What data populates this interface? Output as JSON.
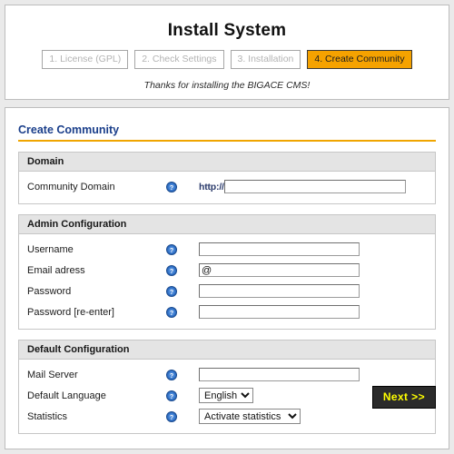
{
  "installer": {
    "title": "Install System",
    "tagline": "Thanks for installing the BIGACE CMS!",
    "steps": [
      {
        "label": "1. License (GPL)",
        "active": false
      },
      {
        "label": "2. Check Settings",
        "active": false
      },
      {
        "label": "3. Installation",
        "active": false
      },
      {
        "label": "4. Create Community",
        "active": true
      }
    ],
    "active_step_color": "#f5a200"
  },
  "page": {
    "section_title": "Create Community",
    "section_title_color": "#1b3f8b",
    "section_rule_color": "#f0a500"
  },
  "fieldsets": {
    "domain": {
      "legend": "Domain",
      "rows": [
        {
          "label": "Community Domain",
          "help_icon": "help-question-icon",
          "protocol_prefix": "http://",
          "value": "",
          "placeholder": ""
        }
      ]
    },
    "admin": {
      "legend": "Admin Configuration",
      "rows": [
        {
          "label": "Username",
          "help_icon": "help-question-icon",
          "value": "",
          "placeholder": ""
        },
        {
          "label": "Email adress",
          "help_icon": "help-question-icon",
          "value": "@",
          "placeholder": ""
        },
        {
          "label": "Password",
          "help_icon": "help-question-icon",
          "value": "",
          "placeholder": ""
        },
        {
          "label": "Password [re-enter]",
          "help_icon": "help-question-icon",
          "value": "",
          "placeholder": ""
        }
      ]
    },
    "defaults": {
      "legend": "Default Configuration",
      "rows": [
        {
          "label": "Mail Server",
          "help_icon": "help-question-icon",
          "value": "",
          "placeholder": ""
        },
        {
          "label": "Default Language",
          "help_icon": "help-question-icon",
          "selected": "English",
          "options": [
            "English"
          ]
        },
        {
          "label": "Statistics",
          "help_icon": "help-question-icon",
          "selected": "Activate statistics",
          "options": [
            "Activate statistics"
          ]
        }
      ]
    }
  },
  "actions": {
    "next_label": "Next >>",
    "next_bg": "#2b2b2b",
    "next_fg": "#ffff00"
  }
}
